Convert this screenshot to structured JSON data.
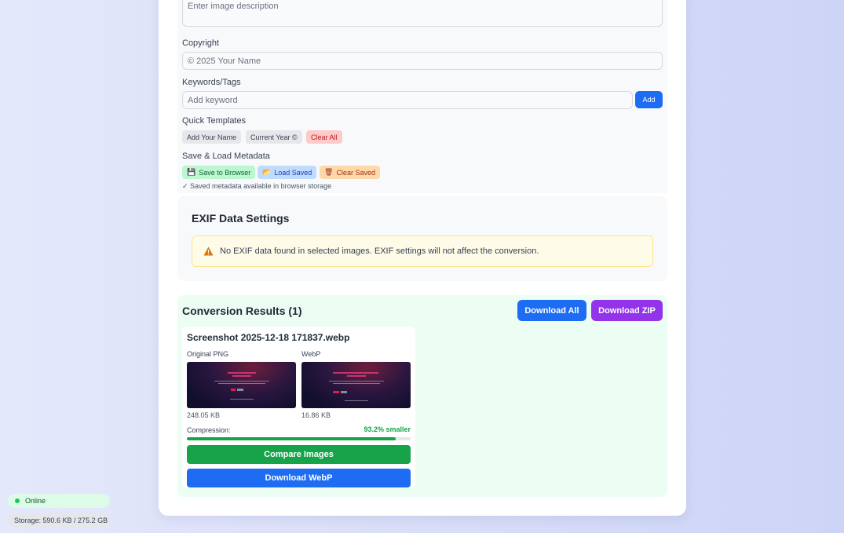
{
  "metadata": {
    "description_placeholder": "Enter image description",
    "copyright_label": "Copyright",
    "copyright_value": "© 2025 Your Name",
    "keywords_label": "Keywords/Tags",
    "keyword_placeholder": "Add keyword",
    "add_label": "Add",
    "templates_label": "Quick Templates",
    "templates": [
      "Add Your Name",
      "Current Year ©",
      "Clear All"
    ],
    "save_load_label": "Save & Load Metadata",
    "save_button": "Save to Browser",
    "load_button": "Load Saved",
    "clear_saved_button": "Clear Saved",
    "saved_note": "✓ Saved metadata available in browser storage"
  },
  "exif": {
    "title": "EXIF Data Settings",
    "warning": "No EXIF data found in selected images. EXIF settings will not affect the conversion."
  },
  "results": {
    "title": "Conversion Results (1)",
    "download_all": "Download All",
    "download_zip": "Download ZIP",
    "file_name": "Screenshot 2025-12-18 171837.webp",
    "original_label": "Original PNG",
    "webp_label": "WebP",
    "original_size": "248.05 KB",
    "webp_size": "16.86 KB",
    "compression_label": "Compression:",
    "compression_value": "93.2% smaller",
    "compression_fraction": 0.932,
    "compare_button": "Compare Images",
    "download_webp_button": "Download WebP"
  },
  "status": {
    "online": "Online",
    "storage": "Storage: 590.6 KB / 275.2 GB"
  },
  "colors": {
    "primary": "#1d6cf2",
    "success": "#16a34a",
    "purple": "#9333ea"
  }
}
